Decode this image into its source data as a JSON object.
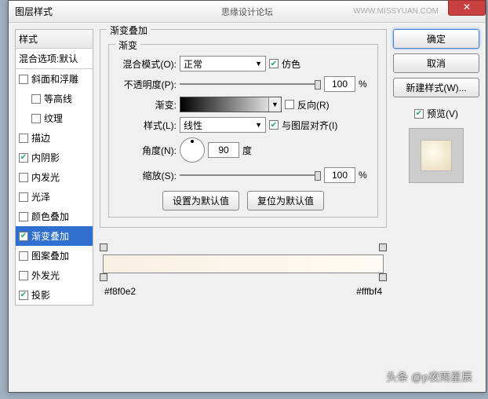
{
  "titlebar": {
    "title": "图层样式",
    "subtitle": "思缘设计论坛",
    "url": "WWW.MISSYUAN.COM",
    "close": "✕"
  },
  "left": {
    "header": "样式",
    "blend": "混合选项:默认",
    "items": [
      {
        "label": "斜面和浮雕",
        "checked": false,
        "sub": false
      },
      {
        "label": "等高线",
        "checked": false,
        "sub": true
      },
      {
        "label": "纹理",
        "checked": false,
        "sub": true
      },
      {
        "label": "描边",
        "checked": false,
        "sub": false
      },
      {
        "label": "内阴影",
        "checked": true,
        "sub": false
      },
      {
        "label": "内发光",
        "checked": false,
        "sub": false
      },
      {
        "label": "光泽",
        "checked": false,
        "sub": false
      },
      {
        "label": "颜色叠加",
        "checked": false,
        "sub": false
      },
      {
        "label": "渐变叠加",
        "checked": true,
        "sub": false,
        "selected": true
      },
      {
        "label": "图案叠加",
        "checked": false,
        "sub": false
      },
      {
        "label": "外发光",
        "checked": false,
        "sub": false
      },
      {
        "label": "投影",
        "checked": true,
        "sub": false
      }
    ]
  },
  "mid": {
    "group_title": "渐变叠加",
    "inner_title": "渐变",
    "blendmode_label": "混合模式(O):",
    "blendmode_value": "正常",
    "dither_label": "仿色",
    "opacity_label": "不透明度(P):",
    "opacity_value": "100",
    "pct": "%",
    "gradient_label": "渐变:",
    "reverse_label": "反向(R)",
    "style_label": "样式(L):",
    "style_value": "线性",
    "align_label": "与图层对齐(I)",
    "angle_label": "角度(N):",
    "angle_value": "90",
    "angle_unit": "度",
    "scale_label": "缩放(S):",
    "scale_value": "100",
    "btn_default": "设置为默认值",
    "btn_reset": "复位为默认值",
    "color_left": "#f8f0e2",
    "color_right": "#fffbf4"
  },
  "right": {
    "ok": "确定",
    "cancel": "取消",
    "newstyle": "新建样式(W)...",
    "preview": "预览(V)"
  },
  "watermark": "头条 @p夜雨星辰"
}
